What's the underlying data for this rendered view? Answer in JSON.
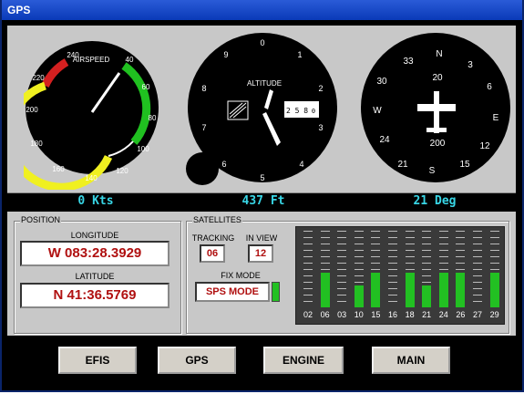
{
  "window": {
    "title": "GPS"
  },
  "readouts": {
    "airspeed": "0 Kts",
    "altitude": "437 Ft",
    "heading": "21 Deg"
  },
  "airspeed": {
    "label": "AIRSPEED",
    "ticks": [
      "240",
      "40",
      "60",
      "80",
      "100",
      "120",
      "140",
      "160",
      "180",
      "200",
      "220"
    ]
  },
  "altimeter": {
    "label": "ALTITUDE",
    "numbers": [
      "0",
      "1",
      "2",
      "3",
      "4",
      "5",
      "6",
      "7",
      "8",
      "9"
    ],
    "drum": "2 5 8",
    "drum_end": "0"
  },
  "heading_ind": {
    "labels": [
      "N",
      "3",
      "6",
      "E",
      "12",
      "15",
      "S",
      "21",
      "24",
      "W",
      "30",
      "33"
    ],
    "top_number": "20",
    "bottom_number": "200"
  },
  "position": {
    "group_label": "POSITION",
    "longitude_label": "LONGITUDE",
    "longitude_value": "W 083:28.3929",
    "latitude_label": "LATITUDE",
    "latitude_value": "N 41:36.5769"
  },
  "satellites": {
    "group_label": "SATELLITES",
    "tracking_label": "TRACKING",
    "tracking_value": "06",
    "inview_label": "IN VIEW",
    "inview_value": "12",
    "fixmode_label": "FIX MODE",
    "fixmode_value": "SPS MODE",
    "fix_color": "#22c022",
    "prns": [
      {
        "prn": "02",
        "level": 0
      },
      {
        "prn": "06",
        "level": 0.45
      },
      {
        "prn": "03",
        "level": 0
      },
      {
        "prn": "10",
        "level": 0.28
      },
      {
        "prn": "15",
        "level": 0.45
      },
      {
        "prn": "16",
        "level": 0
      },
      {
        "prn": "18",
        "level": 0.45
      },
      {
        "prn": "21",
        "level": 0.28
      },
      {
        "prn": "24",
        "level": 0.45
      },
      {
        "prn": "26",
        "level": 0.45
      },
      {
        "prn": "27",
        "level": 0
      },
      {
        "prn": "29",
        "level": 0.45
      }
    ]
  },
  "buttons": {
    "efis": "EFIS",
    "gps": "GPS",
    "engine": "ENGINE",
    "main": "MAIN"
  },
  "colors": {
    "readout": "#38d6e6",
    "value_text": "#b01010",
    "bar_green": "#22c022"
  }
}
